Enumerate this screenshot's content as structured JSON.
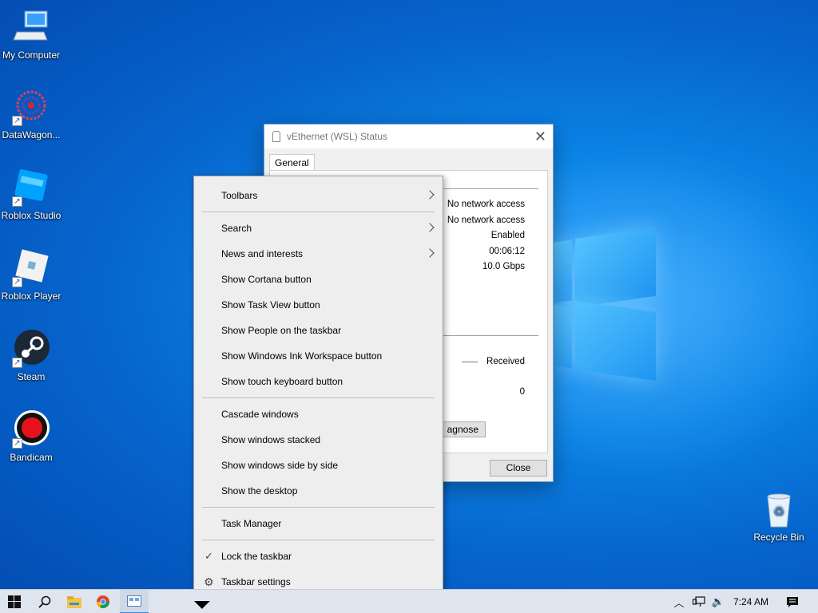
{
  "desktop": {
    "icons": [
      {
        "label": "My Computer",
        "icon": "computer-icon"
      },
      {
        "label": "DataWagon...",
        "icon": "datawagon-icon"
      },
      {
        "label": "Roblox Studio",
        "icon": "roblox-studio-icon"
      },
      {
        "label": "Roblox Player",
        "icon": "roblox-player-icon"
      },
      {
        "label": "Steam",
        "icon": "steam-icon"
      },
      {
        "label": "Bandicam",
        "icon": "bandicam-icon"
      }
    ],
    "recycle_bin": {
      "label": "Recycle Bin",
      "icon": "recycle-bin-icon"
    }
  },
  "dialog": {
    "title": "vEthernet (WSL) Status",
    "tab": "General",
    "connection": {
      "ipv4": "No network access",
      "ipv6": "No network access",
      "media_state": "Enabled",
      "duration": "00:06:12",
      "speed": "10.0 Gbps"
    },
    "activity": {
      "received_label": "Received",
      "received_value": "0"
    },
    "diagnose_label": "agnose",
    "close_label": "Close"
  },
  "context_menu": {
    "groups": [
      [
        {
          "label": "Toolbars",
          "submenu": true
        }
      ],
      [
        {
          "label": "Search",
          "submenu": true
        },
        {
          "label": "News and interests",
          "submenu": true
        },
        {
          "label": "Show Cortana button"
        },
        {
          "label": "Show Task View button"
        },
        {
          "label": "Show People on the taskbar"
        },
        {
          "label": "Show Windows Ink Workspace button"
        },
        {
          "label": "Show touch keyboard button"
        }
      ],
      [
        {
          "label": "Cascade windows"
        },
        {
          "label": "Show windows stacked"
        },
        {
          "label": "Show windows side by side"
        },
        {
          "label": "Show the desktop"
        }
      ],
      [
        {
          "label": "Task Manager"
        }
      ],
      [
        {
          "label": "Lock the taskbar",
          "checked": true
        },
        {
          "label": "Taskbar settings",
          "icon": "gear-icon"
        }
      ]
    ]
  },
  "taskbar": {
    "apps": [
      "start-icon",
      "search-icon",
      "file-explorer-icon",
      "chrome-icon",
      "network-status-icon"
    ],
    "tray": {
      "time": "7:24 AM"
    }
  },
  "colors": {
    "desktop_blue": "#0664cc",
    "menu_bg": "#eeeeee",
    "taskbar_bg": "#dfe5ee"
  }
}
